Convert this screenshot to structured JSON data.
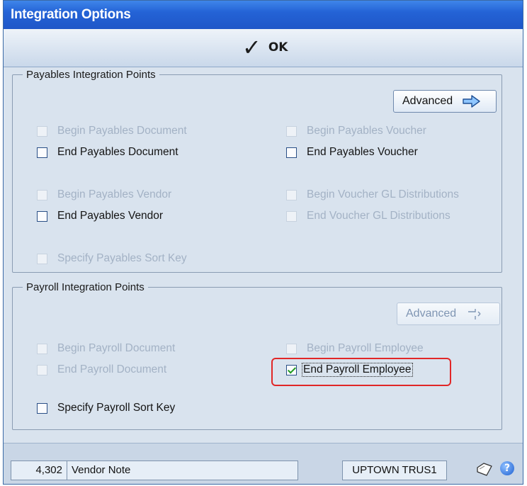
{
  "window": {
    "title": "Integration Options"
  },
  "toolbar": {
    "ok_label": "OK"
  },
  "payables": {
    "legend": "Payables Integration Points",
    "advanced_label": "Advanced",
    "checkboxes": {
      "begin_doc": "Begin Payables Document",
      "end_doc": "End Payables Document",
      "begin_vendor": "Begin Payables Vendor",
      "end_vendor": "End Payables Vendor",
      "sort_key": "Specify Payables Sort Key",
      "begin_voucher": "Begin Payables Voucher",
      "end_voucher": "End Payables Voucher",
      "begin_gl": "Begin Voucher GL Distributions",
      "end_gl": "End Voucher GL Distributions"
    }
  },
  "payroll": {
    "legend": "Payroll Integration Points",
    "advanced_label": "Advanced",
    "checkboxes": {
      "begin_doc": "Begin Payroll Document",
      "end_doc": "End Payroll Document",
      "sort_key": "Specify Payroll Sort Key",
      "begin_emp": "Begin Payroll Employee",
      "end_emp": "End Payroll Employee"
    }
  },
  "status": {
    "record_number": "4,302",
    "record_label": "Vendor Note",
    "company": "UPTOWN TRUS1"
  },
  "icons": {
    "ok": "checkmark-icon",
    "advanced_payables": "arrow-right-icon",
    "advanced_payroll": "arrow-right-disabled-icon",
    "note": "note-icon",
    "help": "help-icon"
  },
  "colors": {
    "titlebar": "#2463d6",
    "highlight": "#e12727",
    "checkmark": "#1f9a1f"
  }
}
